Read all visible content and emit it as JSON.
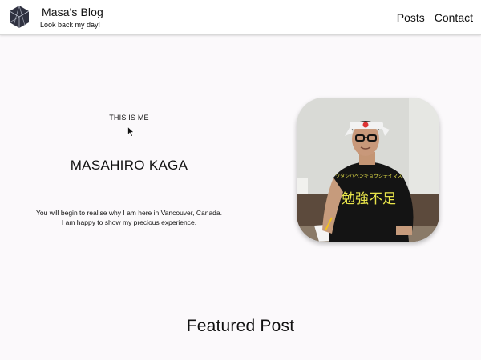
{
  "header": {
    "title": "Masa's Blog",
    "tagline": "Look back my day!",
    "logo_icon": "hexagon-logo-icon",
    "nav": [
      {
        "label": "Posts"
      },
      {
        "label": "Contact"
      }
    ]
  },
  "hero": {
    "eyebrow": "THIS IS ME",
    "name": "MASAHIRO KAGA",
    "description_line1": "You will begin to realise why I am here in Vancouver, Canada.",
    "description_line2": "I am happy to show my precious experience.",
    "photo_text": "勉強不足",
    "photo_small_text": "ワタシハベンキョウシテイマス"
  },
  "featured": {
    "heading": "Featured Post"
  },
  "colors": {
    "header_bg": "#ffffff",
    "page_bg": "#fbf9fb",
    "text": "#111111",
    "photo_shirt": "#111111",
    "photo_kanji": "#e8e44a"
  }
}
